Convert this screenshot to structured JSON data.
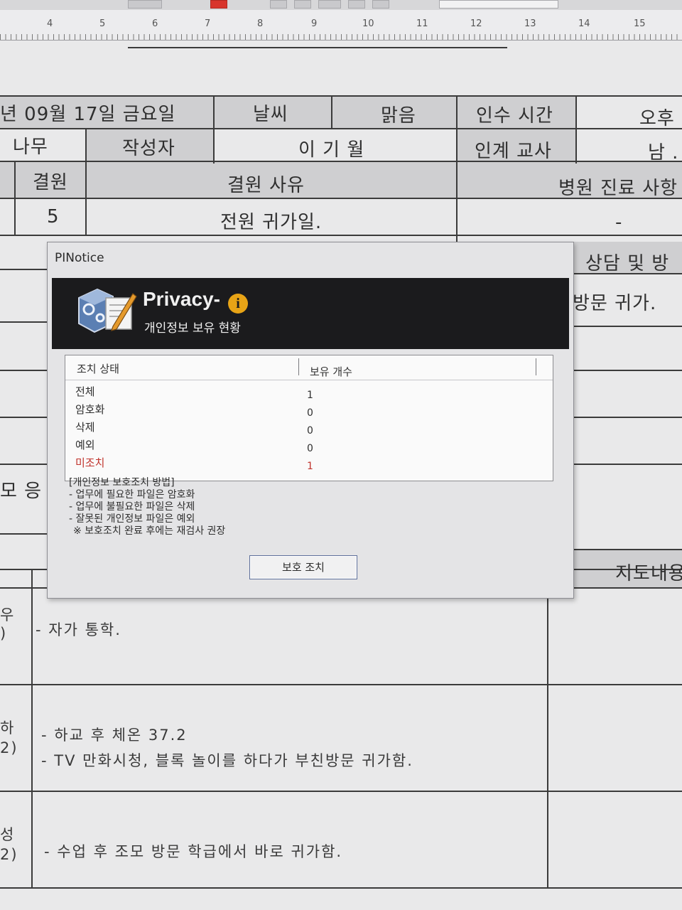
{
  "ruler": {
    "numbers": [
      "4",
      "5",
      "6",
      "7",
      "8",
      "9",
      "10",
      "11",
      "12",
      "13",
      "14",
      "15"
    ]
  },
  "document": {
    "row1": {
      "date": "년 09월 17일 금요일",
      "weather_label": "날씨",
      "weather_value": "맑음",
      "handover_time_label": "인수 시간",
      "handover_time_value": "오후"
    },
    "row2": {
      "class_name": "나무",
      "author_label": "작성자",
      "author_value": "이 기 월",
      "handover_teacher_label": "인계 교사",
      "handover_teacher_value": "남 ."
    },
    "row3": {
      "absent_label": "결원",
      "absent_reason_label": "결원 사유",
      "hospital_label": "병원 진료 사항"
    },
    "row4": {
      "absent_count": "5",
      "absent_reason": "전원 귀가일.",
      "hospital_value": "-"
    },
    "right_labels": {
      "counsel": "상담 및 방",
      "visit_home": "방문 귀가.",
      "guidance": "지도내용"
    },
    "left_fragment": "모 응",
    "students": [
      {
        "side": "우\n)",
        "note_lines": [
          "- 자가 통학."
        ]
      },
      {
        "side": "하\n2)",
        "note_lines": [
          "- 하교 후 체온 37.2",
          "- TV 만화시청, 블록 놀이를 하다가 부친방문 귀가함."
        ]
      },
      {
        "side": "성\n2)",
        "note_lines": [
          "- 수업 후 조모 방문 학급에서 바로 귀가함."
        ]
      }
    ]
  },
  "dialog": {
    "title": "PINotice",
    "banner_title": "Privacy-",
    "banner_badge": "i",
    "banner_subtitle": "개인정보 보유 현황",
    "list": {
      "col_status": "조치 상태",
      "col_count": "보유 개수",
      "rows": [
        {
          "label": "전체",
          "value": "1",
          "warn": false
        },
        {
          "label": "암호화",
          "value": "0",
          "warn": false
        },
        {
          "label": "삭제",
          "value": "0",
          "warn": false
        },
        {
          "label": "예외",
          "value": "0",
          "warn": false
        },
        {
          "label": "미조치",
          "value": "1",
          "warn": true
        }
      ]
    },
    "guide": [
      "[개인정보 보호조치 방법]",
      "- 업무에 필요한 파일은 암호화",
      "- 업무에 불필요한 파일은 삭제",
      "- 잘못된 개인정보 파일은 예외",
      "※ 보호조치 완료 후에는 재검사 권장"
    ],
    "button_label": "보호 조치"
  },
  "colors": {
    "banner_bg": "#1b1b1d",
    "badge": "#e8a416",
    "warning": "#c0322b"
  },
  "icons": {
    "app": "document-pencil-gear-icon",
    "badge": "info-icon"
  }
}
